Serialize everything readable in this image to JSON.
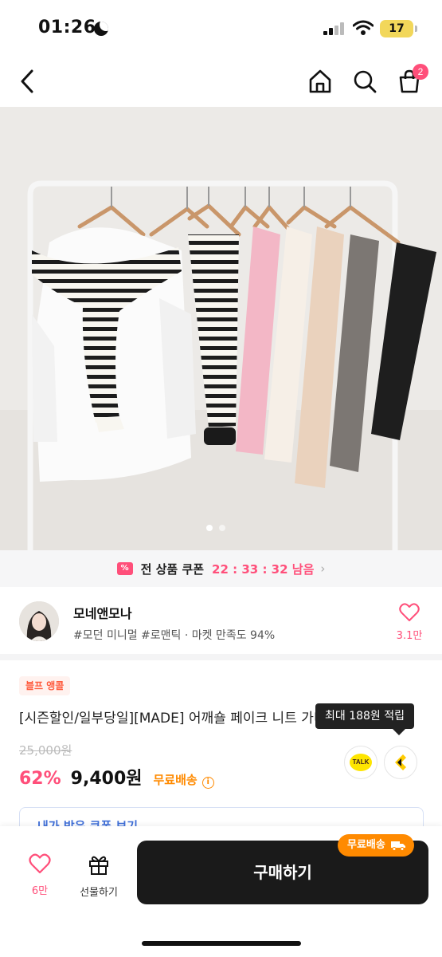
{
  "status_bar": {
    "time": "01:26",
    "battery": "17"
  },
  "nav": {
    "cart_count": "2"
  },
  "coupon_bar": {
    "icon_text": "%",
    "label": "전 상품 쿠폰",
    "timer": "22 : 33 : 32 남음"
  },
  "store": {
    "name": "모네앤모나",
    "tags": "#모던 미니멀 #로맨틱 · 마켓 만족도 94%",
    "likes": "3.1만"
  },
  "product": {
    "badge": "블프 앵콜",
    "title": "[시즌할인/일부당일][MADE] 어깨숄 페이크 니트 가디건",
    "original_price": "25,000원",
    "discount": "62%",
    "price": "9,400원",
    "shipping": "무료배송",
    "tooltip": "최대 188원 적립",
    "talk_label": "TALK"
  },
  "coupon_box": {
    "label": "내가 받은 쿠폰 보기"
  },
  "bottom": {
    "like_label": "6만",
    "gift_label": "선물하기",
    "buy_label": "구매하기",
    "ship_chip": "무료배송"
  },
  "colors": {
    "accent": "#ff4f7a",
    "shipping": "#ff8a00",
    "buy": "#1a1a1a"
  },
  "icons": [
    "moon-icon",
    "signal-icon",
    "wifi-icon",
    "back-icon",
    "home-icon",
    "search-icon",
    "cart-icon",
    "coupon-icon",
    "heart-icon",
    "info-icon",
    "kakao-talk-icon",
    "kakao-point-icon",
    "gift-icon",
    "truck-icon"
  ]
}
